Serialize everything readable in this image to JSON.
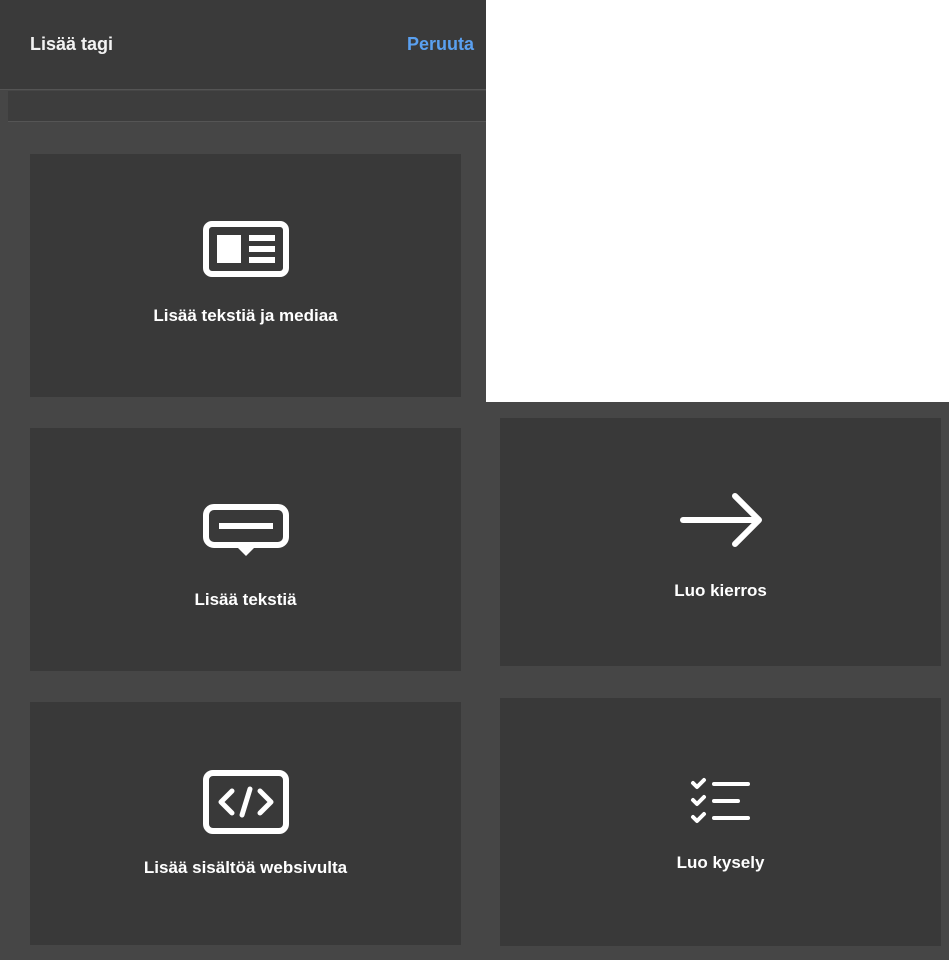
{
  "header": {
    "title": "Lisää tagi",
    "cancel_label": "Peruuta"
  },
  "cards": {
    "text_media": {
      "label": "Lisää tekstiä ja mediaa",
      "icon": "text-media-icon"
    },
    "text": {
      "label": "Lisää tekstiä",
      "icon": "speech-bubble-icon"
    },
    "web_content": {
      "label": "Lisää sisältöä websivulta",
      "icon": "code-icon"
    },
    "tour": {
      "label": "Luo kierros",
      "icon": "arrow-right-icon"
    },
    "quiz": {
      "label": "Luo kysely",
      "icon": "checklist-icon"
    }
  },
  "colors": {
    "panel_bg": "#464646",
    "card_bg": "#393939",
    "accent": "#5aa0f0"
  }
}
